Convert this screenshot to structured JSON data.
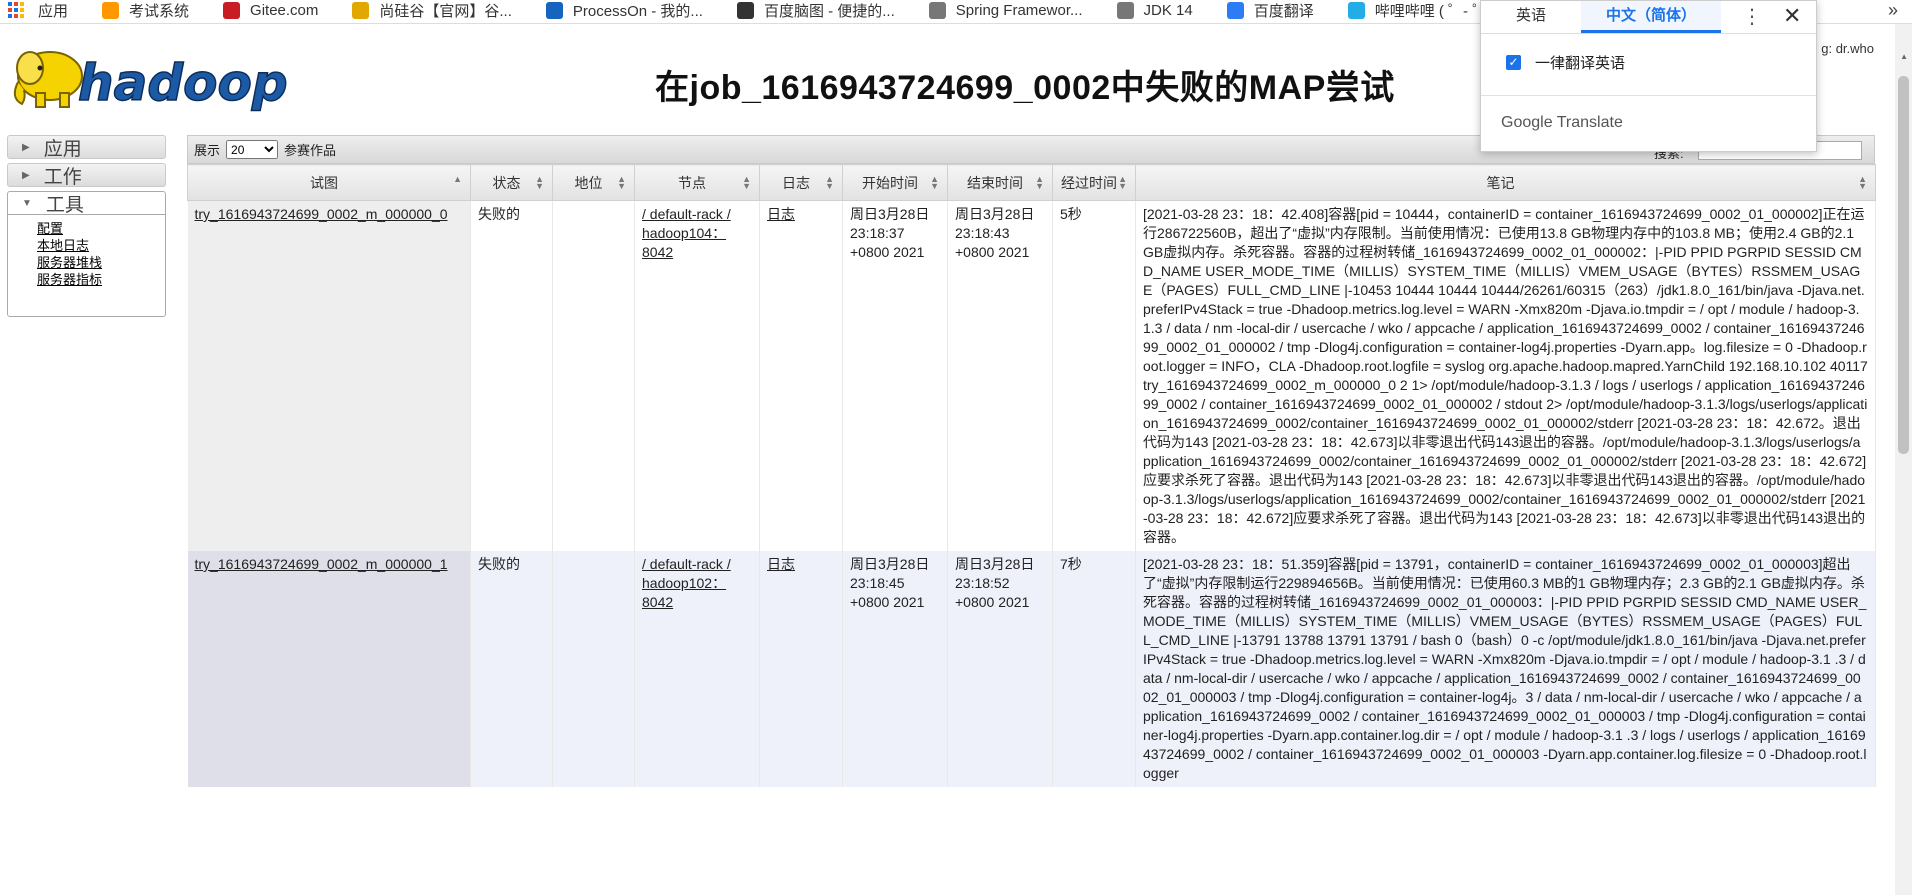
{
  "bookmarks": [
    {
      "label": "应用",
      "icon": "apps-grid-icon",
      "color": "#1a73e8"
    },
    {
      "label": "考试系统",
      "icon": "flame-icon",
      "color": "#ff9800"
    },
    {
      "label": "Gitee.com",
      "icon": "gitee-icon",
      "color": "#c71d23"
    },
    {
      "label": "尚硅谷【官网】谷...",
      "icon": "shangguigu-icon",
      "color": "#e0a800"
    },
    {
      "label": "ProcessOn - 我的...",
      "icon": "processon-icon",
      "color": "#1565c0"
    },
    {
      "label": "百度脑图 - 便捷的...",
      "icon": "baidu-naotu-icon",
      "color": "#333333"
    },
    {
      "label": "Spring Framewor...",
      "icon": "spring-icon",
      "color": "#777777"
    },
    {
      "label": "JDK 14",
      "icon": "jdk-icon",
      "color": "#777777"
    },
    {
      "label": "百度翻译",
      "icon": "baidu-fanyi-icon",
      "color": "#2d7cf6"
    },
    {
      "label": "哔哩哔哩 ( ゜- ゜)つ...",
      "icon": "bilibili-icon",
      "color": "#23ade5"
    }
  ],
  "more_bookmarks": "»",
  "header": {
    "title": "在job_1616943724699_0002中失败的MAP尝试",
    "logo_text": "hadoop",
    "user_info": "g: dr.who"
  },
  "sidebar": {
    "collapsed": [
      {
        "label": "应用"
      },
      {
        "label": "工作"
      }
    ],
    "open": {
      "label": "工具",
      "links": [
        "配置",
        "本地日志",
        "服务器堆栈",
        "服务器指标"
      ]
    }
  },
  "toolbar": {
    "show_label": "展示",
    "page_size": "20",
    "entries_label": "参赛作品",
    "search_label": "搜索:"
  },
  "table": {
    "columns": [
      "试图",
      "状态",
      "地位",
      "节点",
      "日志",
      "开始时间",
      "结束时间",
      "经过时间",
      "笔记"
    ],
    "rows": [
      {
        "attempt": "try_1616943724699_0002_m_000000_0",
        "state": "失败的",
        "status": "",
        "node": "/ default-rack / hadoop104：8042",
        "logs": "日志",
        "start": "周日3月28日 23:18:37 +0800 2021",
        "finish": "周日3月28日 23:18:43 +0800 2021",
        "elapsed": "5秒",
        "notes": "[2021-03-28 23：18：42.408]容器[pid = 10444，containerID = container_1616943724699_0002_01_000002]正在运行286722560B，超出了“虚拟”内存限制。当前使用情况：已使用13.8 GB物理内存中的103.8 MB；使用2.4 GB的2.1 GB虚拟内存。杀死容器。容器的过程树转储_1616943724699_0002_01_000002：|-PID PPID PGRPID SESSID CMD_NAME USER_MODE_TIME（MILLIS）SYSTEM_TIME（MILLIS）VMEM_USAGE（BYTES）RSSMEM_USAGE（PAGES）FULL_CMD_LINE |-10453 10444 10444 10444/26261/60315（263）/jdk1.8.0_161/bin/java -Djava.net.preferIPv4Stack = true -Dhadoop.metrics.log.level = WARN -Xmx820m -Djava.io.tmpdir = / opt / module / hadoop-3.1.3 / data / nm -local-dir / usercache / wko / appcache / application_1616943724699_0002 / container_1616943724699_0002_01_000002 / tmp -Dlog4j.configuration = container-log4j.properties -Dyarn.app。log.filesize = 0 -Dhadoop.root.logger = INFO，CLA -Dhadoop.root.logfile = syslog org.apache.hadoop.mapred.YarnChild 192.168.10.102 40117 try_1616943724699_0002_m_000000_0 2 1> /opt/module/hadoop-3.1.3 / logs / userlogs / application_1616943724699_0002 / container_1616943724699_0002_01_000002 / stdout 2> /opt/module/hadoop-3.1.3/logs/userlogs/application_1616943724699_0002/container_1616943724699_0002_01_000002/stderr [2021-03-28 23：18：42.672。退出代码为143 [2021-03-28 23：18：42.673]以非零退出代码143退出的容器。/opt/module/hadoop-3.1.3/logs/userlogs/application_1616943724699_0002/container_1616943724699_0002_01_000002/stderr [2021-03-28 23：18：42.672]应要求杀死了容器。退出代码为143 [2021-03-28 23：18：42.673]以非零退出代码143退出的容器。/opt/module/hadoop-3.1.3/logs/userlogs/application_1616943724699_0002/container_1616943724699_0002_01_000002/stderr [2021-03-28 23：18：42.672]应要求杀死了容器。退出代码为143 [2021-03-28 23：18：42.673]以非零退出代码143退出的容器。"
      },
      {
        "attempt": "try_1616943724699_0002_m_000000_1",
        "state": "失败的",
        "status": "",
        "node": "/ default-rack / hadoop102：8042",
        "logs": "日志",
        "start": "周日3月28日 23:18:45 +0800 2021",
        "finish": "周日3月28日 23:18:52 +0800 2021",
        "elapsed": "7秒",
        "notes": "[2021-03-28 23：18：51.359]容器[pid = 13791，containerID = container_1616943724699_0002_01_000003]超出了“虚拟”内存限制运行229894656B。当前使用情况：已使用60.3 MB的1 GB物理内存；2.3 GB的2.1 GB虚拟内存。杀死容器。容器的过程树转储_1616943724699_0002_01_000003：|-PID PPID PGRPID SESSID CMD_NAME USER_MODE_TIME（MILLIS）SYSTEM_TIME（MILLIS）VMEM_USAGE（BYTES）RSSMEM_USAGE（PAGES）FULL_CMD_LINE |-13791 13788 13791 13791 / bash 0（bash）0 -c /opt/module/jdk1.8.0_161/bin/java -Djava.net.preferIPv4Stack = true -Dhadoop.metrics.log.level = WARN -Xmx820m -Djava.io.tmpdir = / opt / module / hadoop-3.1 .3 / data / nm-local-dir / usercache / wko / appcache / application_1616943724699_0002 / container_1616943724699_0002_01_000003 / tmp -Dlog4j.configuration = container-log4j。3 / data / nm-local-dir / usercache / wko / appcache / application_1616943724699_0002 / container_1616943724699_0002_01_000003 / tmp -Dlog4j.configuration = container-log4j.properties -Dyarn.app.container.log.dir = / opt / module / hadoop-3.1 .3 / logs / userlogs / application_1616943724699_0002 / container_1616943724699_0002_01_000003 -Dyarn.app.container.log.filesize = 0 -Dhadoop.root.logger"
      }
    ]
  },
  "translate_popup": {
    "tab_source": "英语",
    "tab_target": "中文（简体）",
    "always_translate": "一律翻译英语",
    "brand": "Google Translate",
    "menu_icon": "more-vert-icon",
    "close_icon": "close-icon"
  },
  "colors": {
    "accent": "#1a73e8",
    "hadoop_yellow": "#f5d300",
    "hadoop_blue": "#1d5aa6"
  }
}
